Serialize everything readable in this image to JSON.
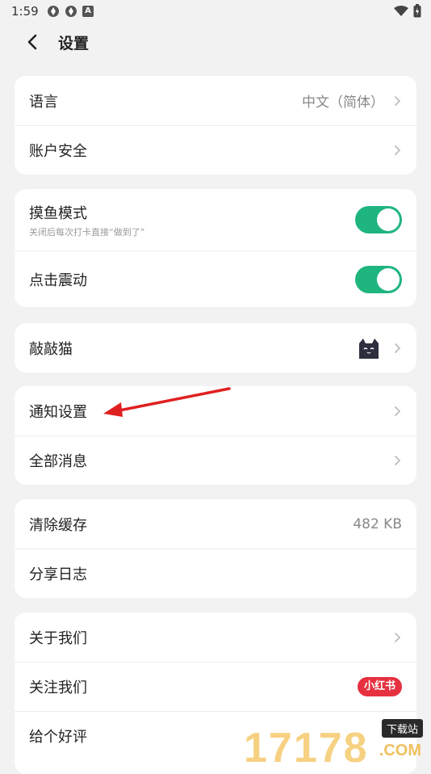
{
  "status_bar": {
    "time": "1:59",
    "notif_letter": "A"
  },
  "header": {
    "title": "设置"
  },
  "sections": {
    "general": {
      "language_label": "语言",
      "language_value": "中文（简体）",
      "account_label": "账户安全"
    },
    "toggles": {
      "fish_mode_label": "摸鱼模式",
      "fish_mode_desc": "关闭后每次打卡直接“做到了”",
      "fish_mode_on": true,
      "vibration_label": "点击震动",
      "vibration_on": true
    },
    "cat": {
      "label": "敲敲猫"
    },
    "notifications": {
      "notify_settings_label": "通知设置",
      "all_messages_label": "全部消息"
    },
    "storage": {
      "clear_cache_label": "清除缓存",
      "cache_size": "482 KB",
      "share_log_label": "分享日志"
    },
    "about": {
      "about_us_label": "关于我们",
      "follow_us_label": "关注我们",
      "follow_badge": "小红书",
      "rate_label": "给个好评"
    }
  },
  "watermark": {
    "digits": "17178",
    "tag": "下载站",
    "suffix": ".COM"
  },
  "colors": {
    "accent_toggle": "#1fb57f",
    "badge_red": "#e6303f",
    "annotation_arrow": "#e02020"
  }
}
